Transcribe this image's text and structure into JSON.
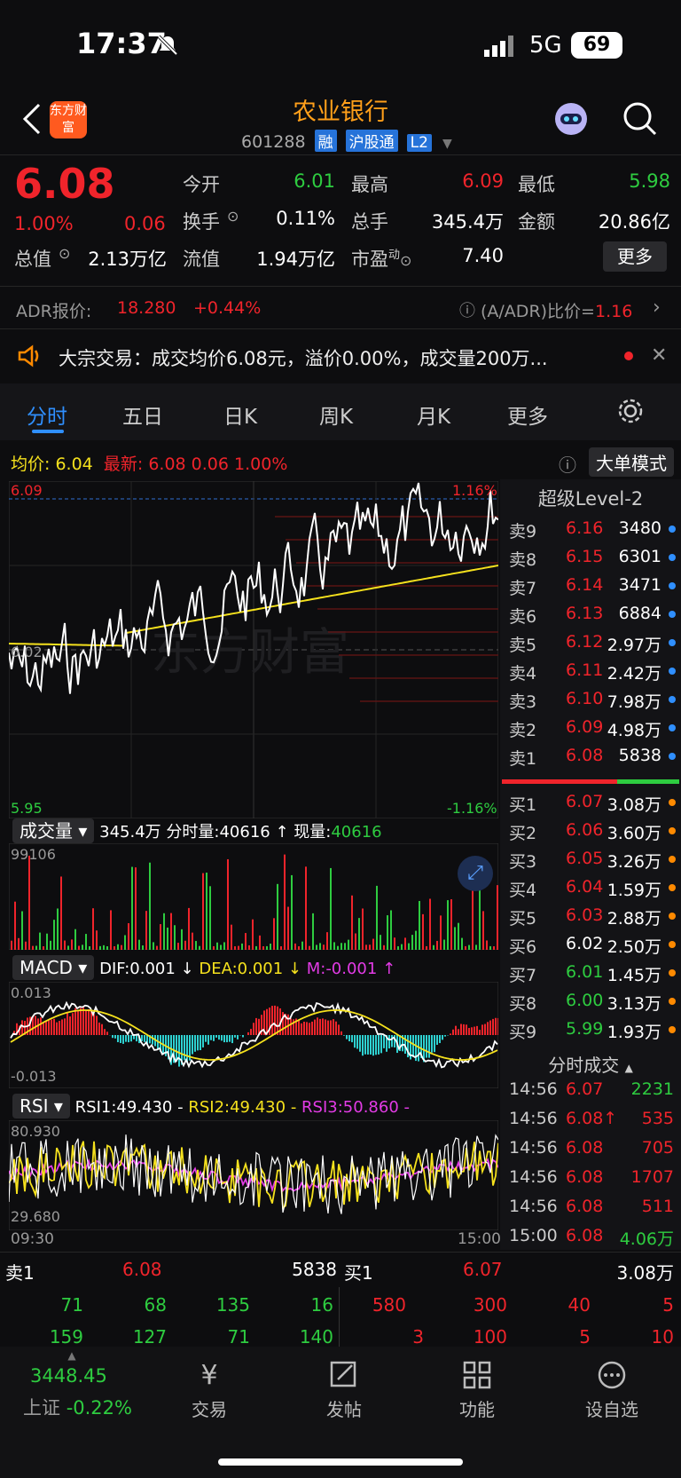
{
  "status": {
    "time": "17:37",
    "network": "5G",
    "battery": "69"
  },
  "header": {
    "title": "农业银行",
    "code": "601288",
    "tags": [
      "融",
      "沪股通",
      "L2"
    ],
    "logo_text": "东方财富"
  },
  "quote": {
    "price": "6.08",
    "change_pct": "1.00%",
    "change": "0.06",
    "open_label": "今开",
    "open": "6.01",
    "high_label": "最高",
    "high": "6.09",
    "low_label": "最低",
    "low": "5.98",
    "turnover_label": "换手",
    "turnover": "0.11%",
    "volume_label": "总手",
    "volume": "345.4万",
    "amount_label": "金额",
    "amount": "20.86亿",
    "mktcap_label": "总值",
    "mktcap": "2.13万亿",
    "float_label": "流值",
    "float": "1.94万亿",
    "pe_label": "市盈",
    "pe_sup": "动",
    "pe": "7.40",
    "more_btn": "更多"
  },
  "adr": {
    "label": "ADR报价:",
    "price": "18.280",
    "change": "+0.44%",
    "ratio_label": "(A/ADR)比价=",
    "ratio": "1.16"
  },
  "notice": {
    "text": "大宗交易：成交均价6.08元，溢价0.00%，成交量200万..."
  },
  "tabs": [
    "分时",
    "五日",
    "日K",
    "周K",
    "月K",
    "更多"
  ],
  "chart_header": {
    "avg_label": "均价:",
    "avg": "6.04",
    "latest_label": "最新:",
    "latest": "6.08",
    "chg": "0.06",
    "pct": "1.00%",
    "mode_btn": "大单模式"
  },
  "chart": {
    "ymax": "6.09",
    "ymid": "6.02",
    "ymin": "5.95",
    "pct_top": "1.16%",
    "pct_bot": "-1.16%",
    "watermark": "东方财富",
    "chart_data": {
      "type": "line",
      "title": "",
      "y_range": [
        5.95,
        6.09
      ],
      "x_range": [
        "09:30",
        "15:00"
      ],
      "series": [
        {
          "name": "均价",
          "color": "#f5e11d"
        },
        {
          "name": "最新",
          "color": "#ffffff"
        }
      ]
    }
  },
  "vol": {
    "selector": "成交量",
    "total": "345.4万",
    "tick_label": "分时量:",
    "tick": "40616",
    "now_label": "现量:",
    "now": "40616",
    "max": "99106"
  },
  "macd": {
    "selector": "MACD",
    "dif": "DIF:0.001",
    "dea": "DEA:0.001",
    "m": "M:-0.001",
    "top": "0.013",
    "bot": "-0.013"
  },
  "rsi": {
    "selector": "RSI",
    "rsi1": "RSI1:49.430",
    "rsi2": "RSI2:49.430",
    "rsi3": "RSI3:50.860",
    "top": "80.930",
    "bot": "29.680",
    "start": "09:30",
    "end": "15:00"
  },
  "level2": {
    "title": "超级Level-2",
    "asks": [
      {
        "label": "卖9",
        "price": "6.16",
        "vol": "3480"
      },
      {
        "label": "卖8",
        "price": "6.15",
        "vol": "6301"
      },
      {
        "label": "卖7",
        "price": "6.14",
        "vol": "3471"
      },
      {
        "label": "卖6",
        "price": "6.13",
        "vol": "6884"
      },
      {
        "label": "卖5",
        "price": "6.12",
        "vol": "2.97万"
      },
      {
        "label": "卖4",
        "price": "6.11",
        "vol": "2.42万"
      },
      {
        "label": "卖3",
        "price": "6.10",
        "vol": "7.98万"
      },
      {
        "label": "卖2",
        "price": "6.09",
        "vol": "4.98万"
      },
      {
        "label": "卖1",
        "price": "6.08",
        "vol": "5838"
      }
    ],
    "bids": [
      {
        "label": "买1",
        "price": "6.07",
        "vol": "3.08万",
        "c": "red"
      },
      {
        "label": "买2",
        "price": "6.06",
        "vol": "3.60万",
        "c": "red"
      },
      {
        "label": "买3",
        "price": "6.05",
        "vol": "3.26万",
        "c": "red"
      },
      {
        "label": "买4",
        "price": "6.04",
        "vol": "1.59万",
        "c": "red"
      },
      {
        "label": "买5",
        "price": "6.03",
        "vol": "2.88万",
        "c": "red"
      },
      {
        "label": "买6",
        "price": "6.02",
        "vol": "2.50万",
        "c": "white"
      },
      {
        "label": "买7",
        "price": "6.01",
        "vol": "1.45万",
        "c": "green"
      },
      {
        "label": "买8",
        "price": "6.00",
        "vol": "3.13万",
        "c": "green"
      },
      {
        "label": "买9",
        "price": "5.99",
        "vol": "1.93万",
        "c": "green"
      }
    ],
    "trades_title": "分时成交",
    "trades": [
      {
        "t": "14:56",
        "p": "6.07",
        "v": "2231",
        "pc": "red",
        "vc": "green"
      },
      {
        "t": "14:56",
        "p": "6.08↑",
        "v": "535",
        "pc": "red",
        "vc": "red"
      },
      {
        "t": "14:56",
        "p": "6.08",
        "v": "705",
        "pc": "red",
        "vc": "red"
      },
      {
        "t": "14:56",
        "p": "6.08",
        "v": "1707",
        "pc": "red",
        "vc": "red"
      },
      {
        "t": "14:56",
        "p": "6.08",
        "v": "511",
        "pc": "red",
        "vc": "red"
      },
      {
        "t": "15:00",
        "p": "6.08",
        "v": "4.06万",
        "pc": "red",
        "vc": "green"
      }
    ]
  },
  "queue": {
    "ask_label": "卖1",
    "ask_price": "6.08",
    "ask_vol": "5838",
    "bid_label": "买1",
    "bid_price": "6.07",
    "bid_vol": "3.08万",
    "ask_row1": [
      "71",
      "68",
      "135",
      "16"
    ],
    "ask_row2": [
      "159",
      "127",
      "71",
      "140"
    ],
    "bid_row1": [
      "580",
      "300",
      "40",
      "5"
    ],
    "bid_row2": [
      "3",
      "100",
      "5",
      "10"
    ]
  },
  "bottom": {
    "index_value": "3448.45",
    "index_name": "上证",
    "index_chg": "-0.22%",
    "nav": [
      "交易",
      "发帖",
      "功能",
      "设自选"
    ]
  }
}
